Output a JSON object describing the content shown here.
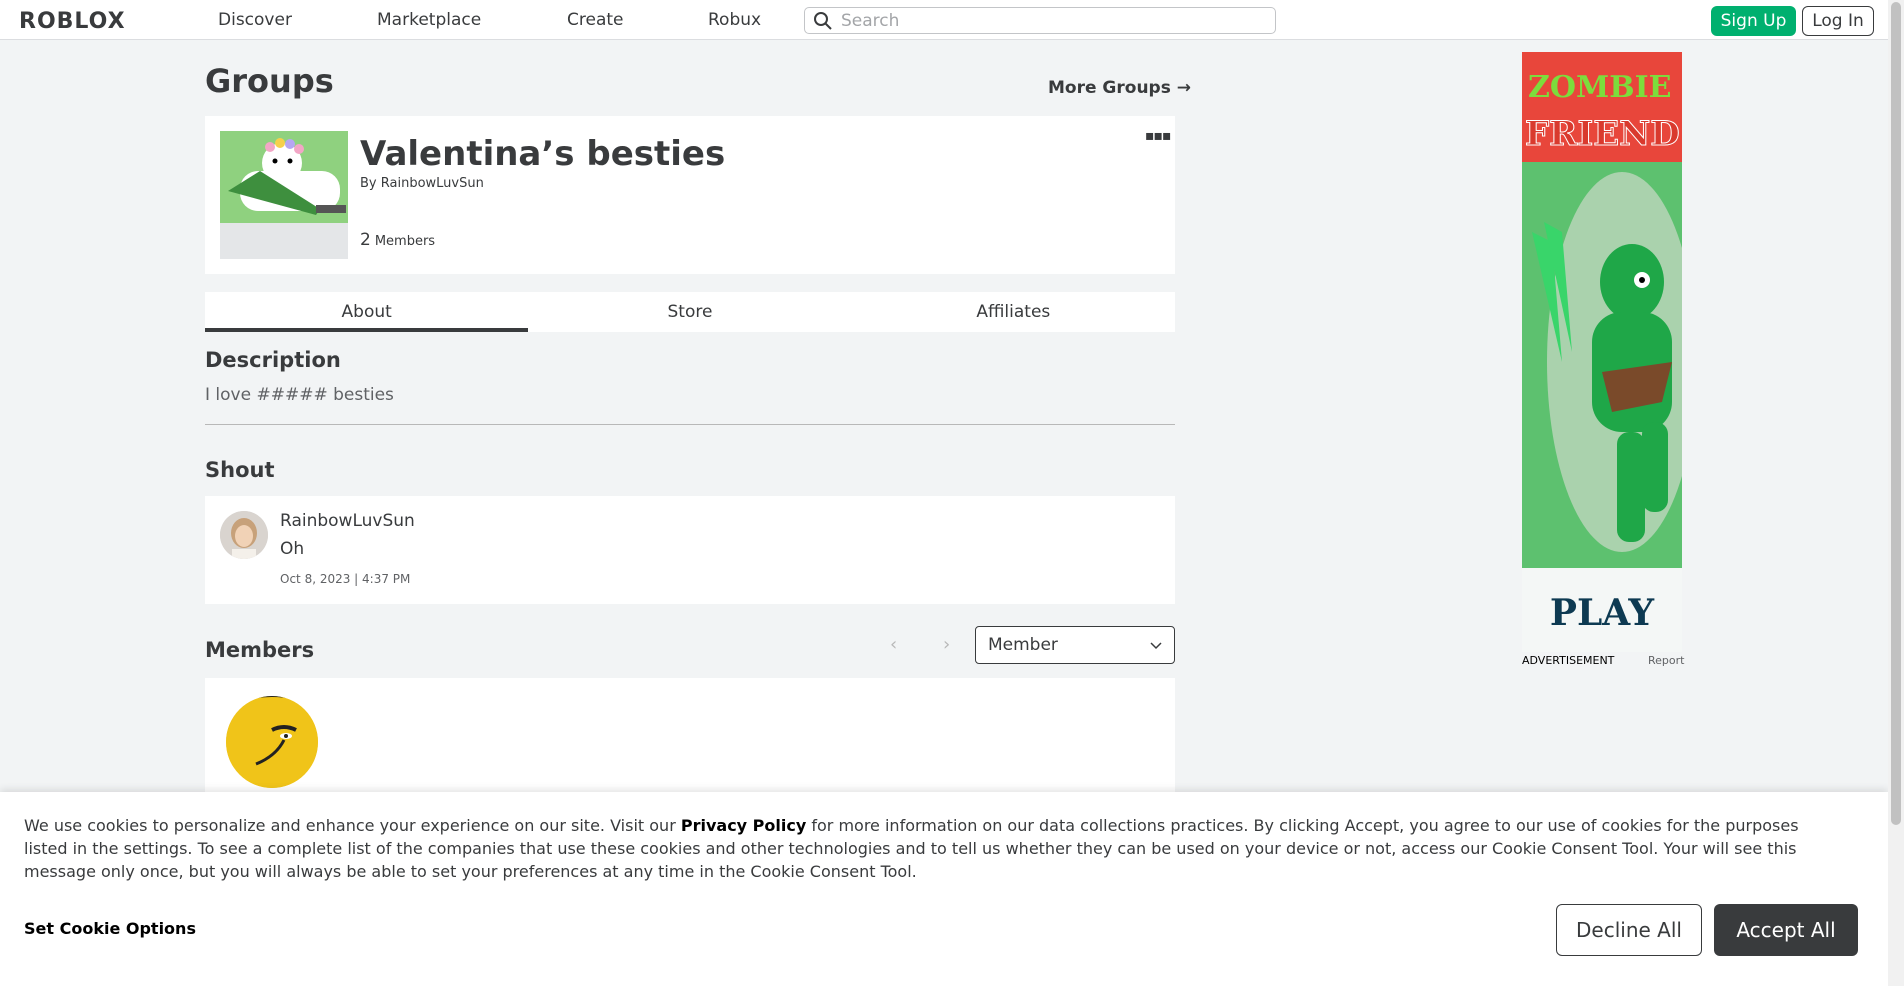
{
  "nav": {
    "logo": "ROBLOX",
    "links": [
      "Discover",
      "Marketplace",
      "Create",
      "Robux"
    ],
    "search_placeholder": "Search",
    "signup": "Sign Up",
    "login": "Log In"
  },
  "header": {
    "title": "Groups",
    "more_groups": "More Groups →"
  },
  "group": {
    "name": "Valentina’s besties",
    "by_prefix": "By",
    "owner": "RainbowLuvSun",
    "member_count": "2",
    "member_label": "Members"
  },
  "tabs": [
    "About",
    "Store",
    "Affiliates"
  ],
  "about": {
    "description_title": "Description",
    "description": "I love ##### besties"
  },
  "shout": {
    "title": "Shout",
    "user": "RainbowLuvSun",
    "body": "Oh",
    "time": "Oct 8, 2023 | 4:37 PM"
  },
  "members": {
    "title": "Members",
    "role_selected": "Member"
  },
  "ad": {
    "line1": "ZOMBIE",
    "line2": "FRIEND",
    "cta": "PLAY",
    "label": "ADVERTISEMENT",
    "report": "Report"
  },
  "cookie": {
    "text_before": "We use cookies to personalize and enhance your experience on our site. Visit our ",
    "link": "Privacy Policy",
    "text_after": " for more information on our data collections practices. By clicking Accept, you agree to our use of cookies for the purposes listed in the settings. To see a complete list of the companies that use these cookies and other technologies and to tell us whether they can be used on your device or not, access our Cookie Consent Tool. Your will see this message only once, but you will always be able to set your preferences at any time in the Cookie Consent Tool.",
    "options": "Set Cookie Options",
    "decline": "Decline All",
    "accept": "Accept All"
  },
  "colors": {
    "signup_green": "#00b06f",
    "text_dark": "#393b3d",
    "background": "#f2f4f5"
  }
}
